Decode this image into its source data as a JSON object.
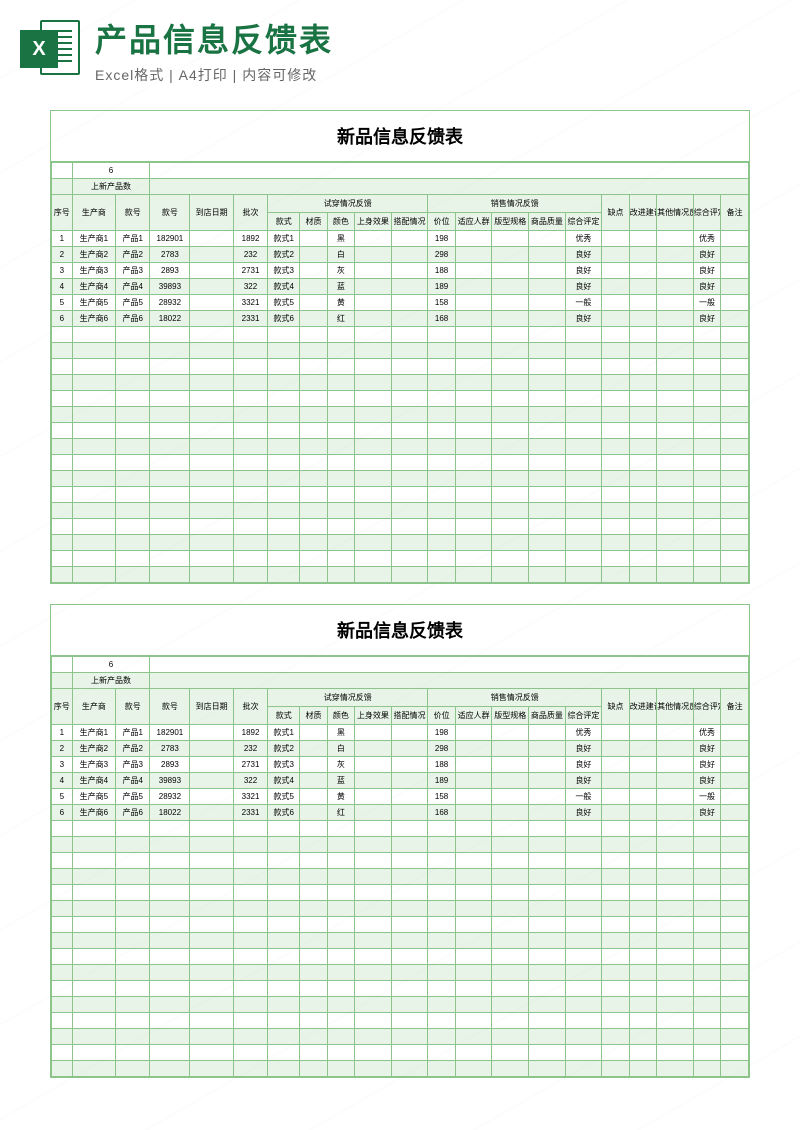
{
  "header": {
    "title": "产品信息反馈表",
    "subtitle": "Excel格式 | A4打印 | 内容可修改",
    "icon_letter": "X"
  },
  "sheet": {
    "title": "新品信息反馈表",
    "count_value": "6",
    "count_label": "上新产品数",
    "group_tryOn": "试穿情况反馈",
    "group_sales": "销售情况反馈",
    "headers": {
      "seq": "序号",
      "supplier": "生产商",
      "code": "款号",
      "num": "款号",
      "date": "到店日期",
      "batch": "批次",
      "style": "款式",
      "material": "材质",
      "color": "颜色",
      "effect": "上身效果",
      "match": "搭配情况",
      "price": "价位",
      "crowd": "适应人群",
      "spec": "版型规格",
      "quality": "商品质量",
      "eval": "综合评定",
      "short": "缺点",
      "suggest": "改进建议",
      "other": "其他情况反馈",
      "comp": "综合评定",
      "note": "备注"
    },
    "rows": [
      {
        "seq": "1",
        "supplier": "生产商1",
        "code": "产品1",
        "num": "182901",
        "date": "",
        "batch": "1892",
        "style": "款式1",
        "material": "",
        "color": "黑",
        "effect": "",
        "match": "",
        "price": "198",
        "crowd": "",
        "spec": "",
        "quality": "",
        "eval": "优秀",
        "short": "",
        "suggest": "",
        "other": "",
        "comp": "优秀",
        "note": ""
      },
      {
        "seq": "2",
        "supplier": "生产商2",
        "code": "产品2",
        "num": "2783",
        "date": "",
        "batch": "232",
        "style": "款式2",
        "material": "",
        "color": "白",
        "effect": "",
        "match": "",
        "price": "298",
        "crowd": "",
        "spec": "",
        "quality": "",
        "eval": "良好",
        "short": "",
        "suggest": "",
        "other": "",
        "comp": "良好",
        "note": ""
      },
      {
        "seq": "3",
        "supplier": "生产商3",
        "code": "产品3",
        "num": "2893",
        "date": "",
        "batch": "2731",
        "style": "款式3",
        "material": "",
        "color": "灰",
        "effect": "",
        "match": "",
        "price": "188",
        "crowd": "",
        "spec": "",
        "quality": "",
        "eval": "良好",
        "short": "",
        "suggest": "",
        "other": "",
        "comp": "良好",
        "note": ""
      },
      {
        "seq": "4",
        "supplier": "生产商4",
        "code": "产品4",
        "num": "39893",
        "date": "",
        "batch": "322",
        "style": "款式4",
        "material": "",
        "color": "蓝",
        "effect": "",
        "match": "",
        "price": "189",
        "crowd": "",
        "spec": "",
        "quality": "",
        "eval": "良好",
        "short": "",
        "suggest": "",
        "other": "",
        "comp": "良好",
        "note": ""
      },
      {
        "seq": "5",
        "supplier": "生产商5",
        "code": "产品5",
        "num": "28932",
        "date": "",
        "batch": "3321",
        "style": "款式5",
        "material": "",
        "color": "黄",
        "effect": "",
        "match": "",
        "price": "158",
        "crowd": "",
        "spec": "",
        "quality": "",
        "eval": "一般",
        "short": "",
        "suggest": "",
        "other": "",
        "comp": "一般",
        "note": ""
      },
      {
        "seq": "6",
        "supplier": "生产商6",
        "code": "产品6",
        "num": "18022",
        "date": "",
        "batch": "2331",
        "style": "款式6",
        "material": "",
        "color": "红",
        "effect": "",
        "match": "",
        "price": "168",
        "crowd": "",
        "spec": "",
        "quality": "",
        "eval": "良好",
        "short": "",
        "suggest": "",
        "other": "",
        "comp": "良好",
        "note": ""
      }
    ],
    "empty_rows": 16
  }
}
